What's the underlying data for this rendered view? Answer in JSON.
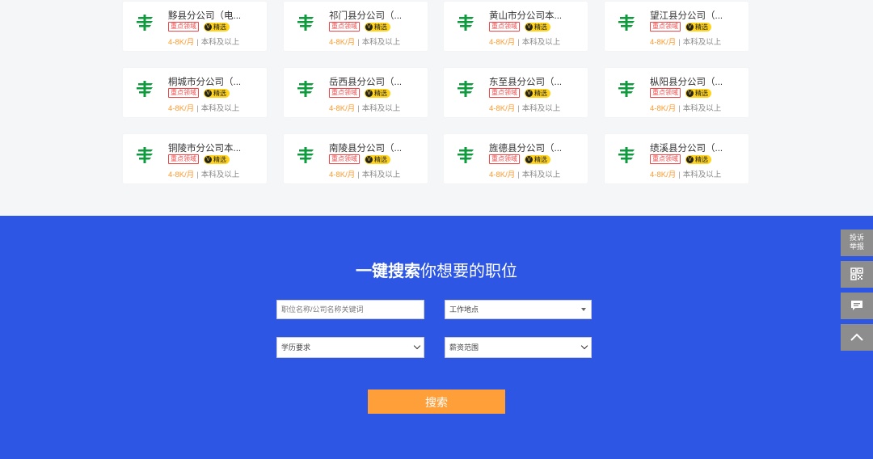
{
  "cards": [
    {
      "title": "黟县分公司（电...",
      "tag1": "重点领域",
      "tag2": "精选",
      "salary": "4-8K/月",
      "edu": "本科及以上"
    },
    {
      "title": "祁门县分公司（...",
      "tag1": "重点领域",
      "tag2": "精选",
      "salary": "4-8K/月",
      "edu": "本科及以上"
    },
    {
      "title": "黄山市分公司本...",
      "tag1": "重点领域",
      "tag2": "精选",
      "salary": "4-8K/月",
      "edu": "本科及以上"
    },
    {
      "title": "望江县分公司（...",
      "tag1": "重点领域",
      "tag2": "精选",
      "salary": "4-8K/月",
      "edu": "本科及以上"
    },
    {
      "title": "桐城市分公司（...",
      "tag1": "重点领域",
      "tag2": "精选",
      "salary": "4-8K/月",
      "edu": "本科及以上"
    },
    {
      "title": "岳西县分公司（...",
      "tag1": "重点领域",
      "tag2": "精选",
      "salary": "4-8K/月",
      "edu": "本科及以上"
    },
    {
      "title": "东至县分公司（...",
      "tag1": "重点领域",
      "tag2": "精选",
      "salary": "4-8K/月",
      "edu": "本科及以上"
    },
    {
      "title": "枞阳县分公司（...",
      "tag1": "重点领域",
      "tag2": "精选",
      "salary": "4-8K/月",
      "edu": "本科及以上"
    },
    {
      "title": "铜陵市分公司本...",
      "tag1": "重点领域",
      "tag2": "精选",
      "salary": "4-8K/月",
      "edu": "本科及以上"
    },
    {
      "title": "南陵县分公司（...",
      "tag1": "重点领域",
      "tag2": "精选",
      "salary": "4-8K/月",
      "edu": "本科及以上"
    },
    {
      "title": "旌德县分公司（...",
      "tag1": "重点领域",
      "tag2": "精选",
      "salary": "4-8K/月",
      "edu": "本科及以上"
    },
    {
      "title": "绩溪县分公司（...",
      "tag1": "重点领域",
      "tag2": "精选",
      "salary": "4-8K/月",
      "edu": "本科及以上"
    }
  ],
  "search": {
    "title_bold": "一键搜索",
    "title_rest": "你想要的职位",
    "keyword_placeholder": "职位名称/公司名称关键词",
    "location_value": "工作地点",
    "education_value": "学历要求",
    "salary_value": "薪资范围",
    "button_label": "搜索",
    "background_color": "#2c56e3",
    "button_color": "#ff9f3a"
  },
  "side_tools": {
    "report_label_1": "投诉",
    "report_label_2": "举报",
    "icons": [
      "qr-code-icon",
      "message-icon",
      "back-to-top-icon"
    ]
  },
  "colors": {
    "logo_green": "#0e9b3d",
    "tag_red": "#f04848",
    "tag_gold": "#ffd31e",
    "salary_orange": "#ff9a2e"
  }
}
